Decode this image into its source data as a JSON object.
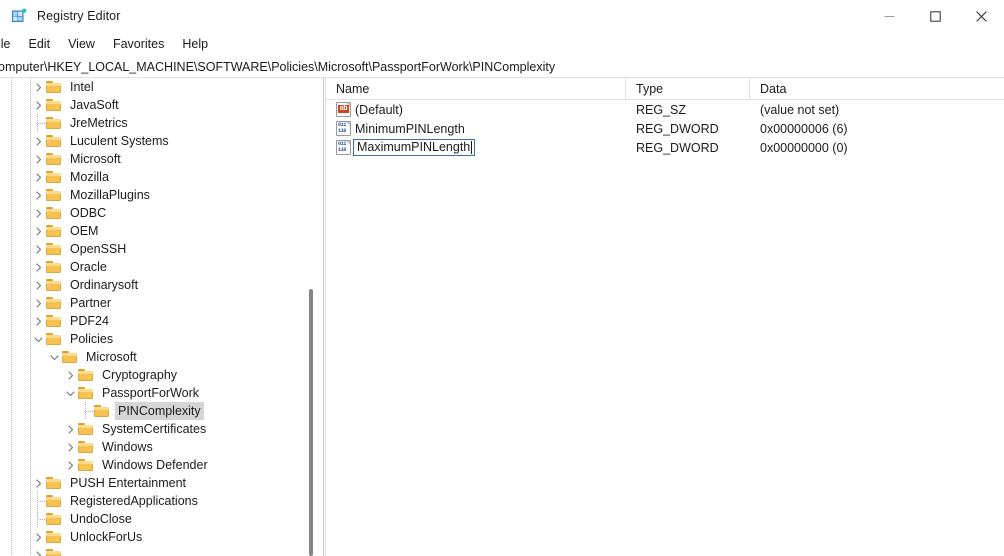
{
  "window": {
    "title": "Registry Editor",
    "icon": "registry-editor-icon",
    "controls": {
      "minimize": "minimize-icon",
      "maximize": "maximize-icon",
      "close": "close-icon"
    }
  },
  "menubar": {
    "items": [
      {
        "label": "ile"
      },
      {
        "label": "Edit"
      },
      {
        "label": "View"
      },
      {
        "label": "Favorites"
      },
      {
        "label": "Help"
      }
    ]
  },
  "addressbar": {
    "path": "omputer\\HKEY_LOCAL_MACHINE\\SOFTWARE\\Policies\\Microsoft\\PassportForWork\\PINComplexity"
  },
  "tree": {
    "items": [
      {
        "label": "Intel",
        "depth": 2,
        "state": "collapsed"
      },
      {
        "label": "JavaSoft",
        "depth": 2,
        "state": "collapsed"
      },
      {
        "label": "JreMetrics",
        "depth": 2,
        "state": "leaf"
      },
      {
        "label": "Luculent Systems",
        "depth": 2,
        "state": "collapsed"
      },
      {
        "label": "Microsoft",
        "depth": 2,
        "state": "collapsed"
      },
      {
        "label": "Mozilla",
        "depth": 2,
        "state": "collapsed"
      },
      {
        "label": "MozillaPlugins",
        "depth": 2,
        "state": "collapsed"
      },
      {
        "label": "ODBC",
        "depth": 2,
        "state": "collapsed"
      },
      {
        "label": "OEM",
        "depth": 2,
        "state": "collapsed"
      },
      {
        "label": "OpenSSH",
        "depth": 2,
        "state": "collapsed"
      },
      {
        "label": "Oracle",
        "depth": 2,
        "state": "collapsed"
      },
      {
        "label": "Ordinarysoft",
        "depth": 2,
        "state": "collapsed"
      },
      {
        "label": "Partner",
        "depth": 2,
        "state": "collapsed"
      },
      {
        "label": "PDF24",
        "depth": 2,
        "state": "collapsed"
      },
      {
        "label": "Policies",
        "depth": 2,
        "state": "expanded"
      },
      {
        "label": "Microsoft",
        "depth": 3,
        "state": "expanded"
      },
      {
        "label": "Cryptography",
        "depth": 4,
        "state": "collapsed"
      },
      {
        "label": "PassportForWork",
        "depth": 4,
        "state": "expanded"
      },
      {
        "label": "PINComplexity",
        "depth": 5,
        "state": "leaf",
        "selected": true
      },
      {
        "label": "SystemCertificates",
        "depth": 4,
        "state": "collapsed"
      },
      {
        "label": "Windows",
        "depth": 4,
        "state": "collapsed"
      },
      {
        "label": "Windows Defender",
        "depth": 4,
        "state": "collapsed"
      },
      {
        "label": "PUSH Entertainment",
        "depth": 2,
        "state": "collapsed"
      },
      {
        "label": "RegisteredApplications",
        "depth": 2,
        "state": "leaf"
      },
      {
        "label": "UndoClose",
        "depth": 2,
        "state": "leaf"
      },
      {
        "label": "UnlockForUs",
        "depth": 2,
        "state": "collapsed"
      },
      {
        "label": "",
        "depth": 2,
        "state": "collapsed"
      }
    ]
  },
  "list": {
    "columns": {
      "name": "Name",
      "type": "Type",
      "data": "Data"
    },
    "rows": [
      {
        "name": "(Default)",
        "type": "REG_SZ",
        "data": "(value not set)",
        "icon": "string-value-icon",
        "editing": false
      },
      {
        "name": "MinimumPINLength",
        "type": "REG_DWORD",
        "data": "0x00000006 (6)",
        "icon": "dword-value-icon",
        "editing": false
      },
      {
        "name": "MaximumPINLength",
        "type": "REG_DWORD",
        "data": "0x00000000 (0)",
        "icon": "dword-value-icon",
        "editing": true
      }
    ]
  },
  "colors": {
    "folder": "#f5c253",
    "selection": "#d5d5d5",
    "edit_border": "#3a6ea5",
    "string_icon": "#c8471f",
    "dword_icon": "#1f4fa8"
  }
}
